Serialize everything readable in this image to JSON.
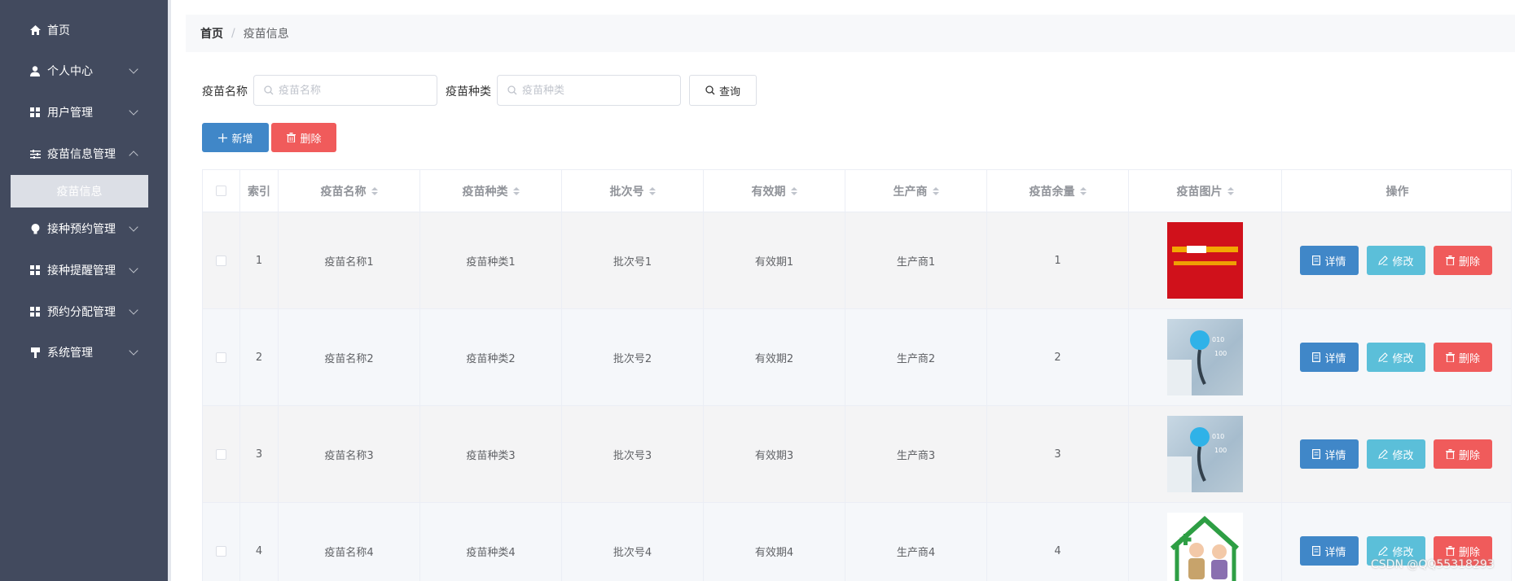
{
  "sidebar": {
    "items": [
      {
        "label": "首页",
        "icon": "home-icon",
        "has_arrow": false
      },
      {
        "label": "个人中心",
        "icon": "user-icon",
        "has_arrow": true
      },
      {
        "label": "用户管理",
        "icon": "grid-icon",
        "has_arrow": true
      },
      {
        "label": "疫苗信息管理",
        "icon": "sliders-icon",
        "has_arrow": true
      },
      {
        "label": "接种预约管理",
        "icon": "bulb-icon",
        "has_arrow": true
      },
      {
        "label": "接种提醒管理",
        "icon": "grid-icon",
        "has_arrow": true
      },
      {
        "label": "预约分配管理",
        "icon": "grid-icon",
        "has_arrow": true
      },
      {
        "label": "系统管理",
        "icon": "bookmark-icon",
        "has_arrow": true
      }
    ],
    "active_sub": "疫苗信息"
  },
  "breadcrumb": {
    "home": "首页",
    "separator": "/",
    "current": "疫苗信息"
  },
  "search": {
    "name_label": "疫苗名称",
    "name_placeholder": "疫苗名称",
    "type_label": "疫苗种类",
    "type_placeholder": "疫苗种类",
    "query_label": "查询"
  },
  "toolbar": {
    "add_label": "新增",
    "delete_label": "删除"
  },
  "table": {
    "headers": [
      "索引",
      "疫苗名称",
      "疫苗种类",
      "批次号",
      "有效期",
      "生产商",
      "疫苗余量",
      "疫苗图片",
      "操作"
    ],
    "rows": [
      {
        "index": "1",
        "name": "疫苗名称1",
        "type": "疫苗种类1",
        "batch": "批次号1",
        "expiry": "有效期1",
        "maker": "生产商1",
        "stock": "1",
        "image": "red-banner"
      },
      {
        "index": "2",
        "name": "疫苗名称2",
        "type": "疫苗种类2",
        "batch": "批次号2",
        "expiry": "有效期2",
        "maker": "生产商2",
        "stock": "2",
        "image": "stethoscope"
      },
      {
        "index": "3",
        "name": "疫苗名称3",
        "type": "疫苗种类3",
        "batch": "批次号3",
        "expiry": "有效期3",
        "maker": "生产商3",
        "stock": "3",
        "image": "stethoscope"
      },
      {
        "index": "4",
        "name": "疫苗名称4",
        "type": "疫苗种类4",
        "batch": "批次号4",
        "expiry": "有效期4",
        "maker": "生产商4",
        "stock": "4",
        "image": "elderly-house"
      }
    ],
    "actions": {
      "detail": "详情",
      "edit": "修改",
      "delete": "删除"
    }
  },
  "colors": {
    "sidebar": "#424a5e",
    "primary": "#4087c8",
    "info": "#5bbfd9",
    "danger": "#f05b5b"
  },
  "watermark": "CSDN @QQ55318293"
}
